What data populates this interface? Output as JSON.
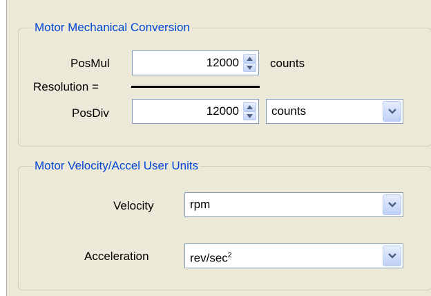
{
  "mechanical": {
    "title": "Motor Mechanical Conversion",
    "resolution_label": "Resolution =",
    "posmul": {
      "label": "PosMul",
      "value": "12000",
      "unit": "counts"
    },
    "posdiv": {
      "label": "PosDiv",
      "value": "12000",
      "unit_selected": "counts"
    }
  },
  "velocity_units": {
    "title": "Motor Velocity/Accel User Units",
    "velocity": {
      "label": "Velocity",
      "selected": "rpm"
    },
    "acceleration": {
      "label": "Acceleration",
      "selected_base": "rev/sec",
      "selected_exp": "2"
    }
  },
  "icons": {
    "spin_up": "triangle-up-icon",
    "spin_down": "triangle-down-icon",
    "dropdown": "chevron-down-icon"
  },
  "colors": {
    "group_title": "#0046d5",
    "panel_bg": "#ece9d8",
    "field_border": "#7f9db9"
  }
}
